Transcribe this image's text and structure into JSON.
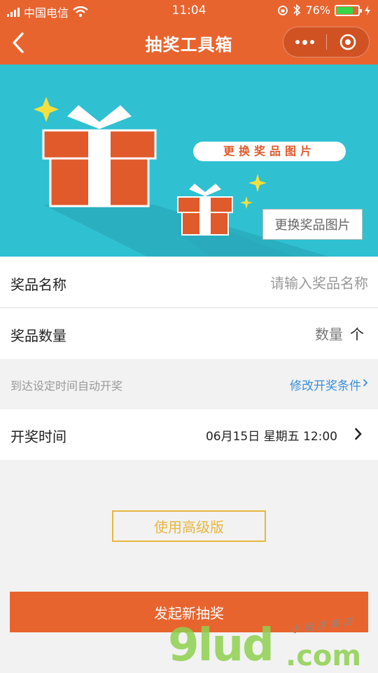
{
  "status_bar": {
    "carrier": "中国电信",
    "time": "11:04",
    "battery": "76%",
    "battery_level": 0.76
  },
  "titlebar": {
    "title": "抽奖工具箱"
  },
  "banner": {
    "ribbon_text": "更换奖品图片",
    "change_button": "更换奖品图片"
  },
  "form": {
    "prize_name": {
      "label": "奖品名称",
      "placeholder": "请输入奖品名称"
    },
    "prize_qty": {
      "label": "奖品数量",
      "placeholder": "数量",
      "unit": "个"
    },
    "hint": {
      "text": "到达设定时间自动开奖",
      "link": "修改开奖条件"
    },
    "draw_time": {
      "label": "开奖时间",
      "value": "06月15日 星期五 12:00"
    }
  },
  "buttons": {
    "advanced": "使用高级版",
    "submit": "发起新抽奖"
  },
  "watermark": {
    "brand": "9lud",
    "tld": ".com",
    "slogan": "小程序商店"
  },
  "colors": {
    "accent": "#e8642f",
    "banner": "#2fc0d2",
    "link": "#3a8ed8",
    "gold": "#e7b73d"
  }
}
